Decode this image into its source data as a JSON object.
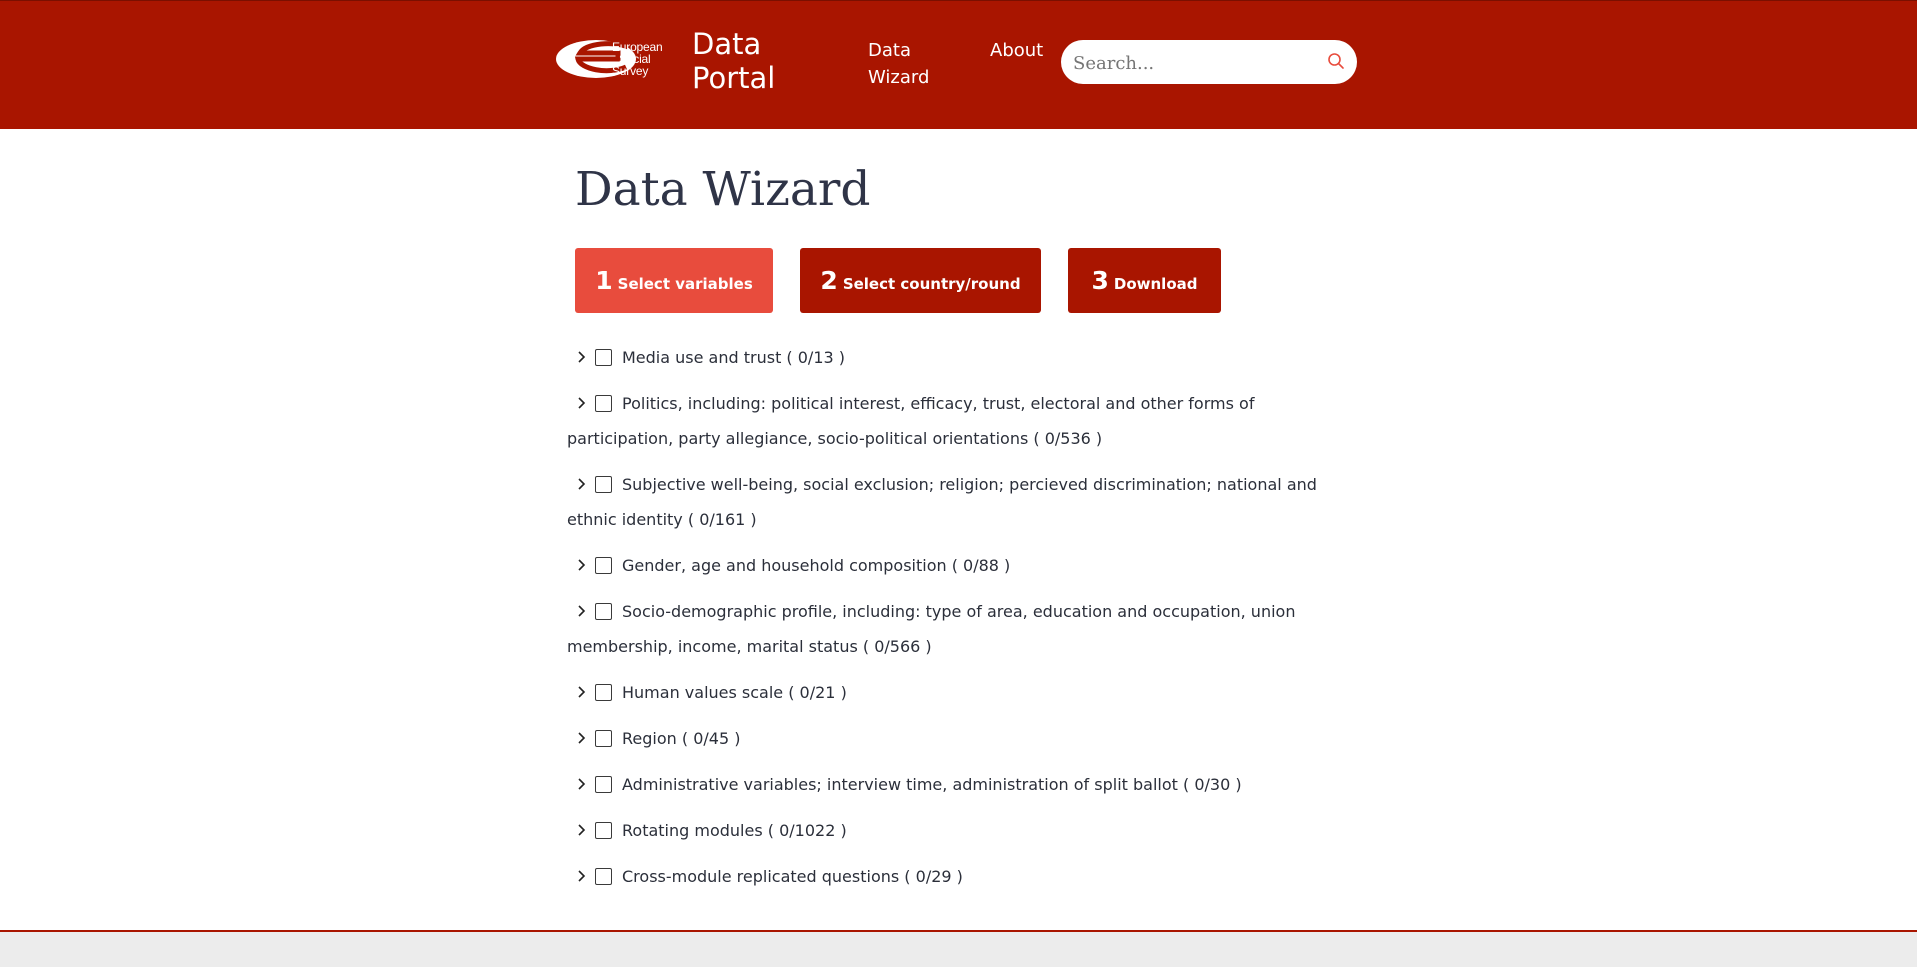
{
  "header": {
    "logo_lines": [
      "European",
      "Social",
      "Survey"
    ],
    "portal_title_line1": "Data",
    "portal_title_line2": "Portal",
    "nav": {
      "wizard_label": "Data Wizard",
      "about_label": "About"
    },
    "search": {
      "placeholder": "Search...",
      "value": ""
    },
    "colors": {
      "bar": "#a91500"
    }
  },
  "main": {
    "title": "Data Wizard",
    "steps": [
      {
        "num": "1",
        "label": "Select variables",
        "state": "active",
        "color": "#e84c3d"
      },
      {
        "num": "2",
        "label": "Select country/round",
        "state": "inactive",
        "color": "#a91500"
      },
      {
        "num": "3",
        "label": "Download",
        "state": "inactive",
        "color": "#a91500"
      }
    ],
    "categories": [
      {
        "label": "Media use and trust ( 0/13 )"
      },
      {
        "label": "Politics, including: political interest, efficacy, trust, electoral and other forms of participation, party allegiance, socio-political orientations ( 0/536 )"
      },
      {
        "label": "Subjective well-being, social exclusion; religion; percieved discrimination; national and ethnic identity ( 0/161 )"
      },
      {
        "label": "Gender, age and household composition ( 0/88 )"
      },
      {
        "label": "Socio-demographic profile, including: type of area, education and occupation, union membership, income, marital status ( 0/566 )"
      },
      {
        "label": "Human values scale ( 0/21 )"
      },
      {
        "label": "Region ( 0/45 )"
      },
      {
        "label": "Administrative variables; interview time, administration of split ballot ( 0/30 )"
      },
      {
        "label": "Rotating modules ( 0/1022 )"
      },
      {
        "label": "Cross-module replicated questions ( 0/29 )"
      }
    ]
  }
}
